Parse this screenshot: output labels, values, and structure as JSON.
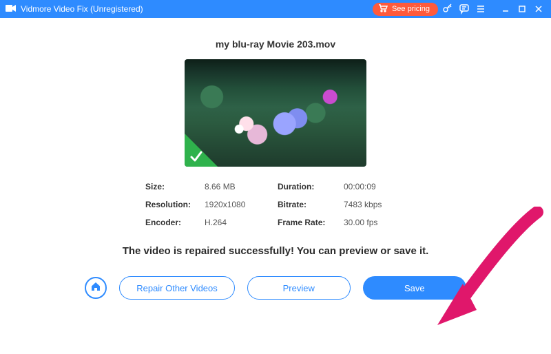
{
  "titlebar": {
    "app_name": "Vidmore Video Fix (Unregistered)",
    "see_pricing_label": "See pricing"
  },
  "file": {
    "name": "my blu-ray Movie 203.mov"
  },
  "meta_labels": {
    "size": "Size:",
    "resolution": "Resolution:",
    "encoder": "Encoder:",
    "duration": "Duration:",
    "bitrate": "Bitrate:",
    "framerate": "Frame Rate:"
  },
  "meta_values": {
    "size": "8.66 MB",
    "resolution": "1920x1080",
    "encoder": "H.264",
    "duration": "00:00:09",
    "bitrate": "7483 kbps",
    "framerate": "30.00 fps"
  },
  "success_message": "The video is repaired successfully! You can preview or save it.",
  "actions": {
    "repair_other": "Repair Other Videos",
    "preview": "Preview",
    "save": "Save"
  }
}
